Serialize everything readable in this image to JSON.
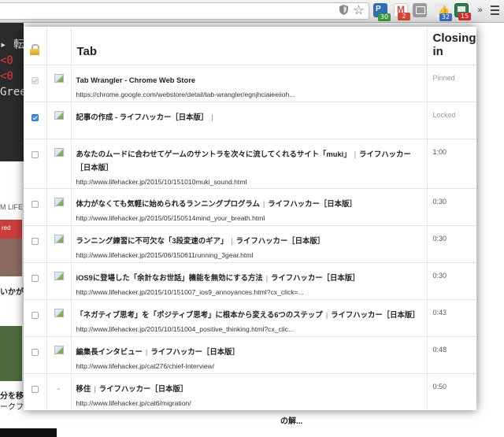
{
  "browser": {
    "extensions": [
      {
        "name": "pushbullet-icon",
        "badge": "30",
        "color": "#2f6db5",
        "badge_color": "#3a9a3a"
      },
      {
        "name": "gmail-icon",
        "badge": "2",
        "color": "#d44638",
        "badge_color": "#d44638"
      },
      {
        "name": "window-icon",
        "badge": "",
        "color": "#8a8a8a",
        "badge_color": ""
      },
      {
        "name": "feedly-icon",
        "badge": "32",
        "color": "#4a7bc8",
        "badge_color": "#3a6fc1"
      },
      {
        "name": "tab-wrangler-icon",
        "badge": "15",
        "color": "#3c9a5a",
        "badge_color": "#d0302a"
      }
    ],
    "overflow_label": "»"
  },
  "background_page": {
    "dark_lines": [
      "▸ 転",
      "<0",
      "<0",
      "Gree"
    ],
    "side_texts": [
      "M LIFE",
      "red",
      "いかが",
      "分を移",
      "ークフ"
    ],
    "bottom_text": "の解..."
  },
  "popup": {
    "header": {
      "tab_label": "Tab",
      "closing_label_line1": "Closing",
      "closing_label_line2": "in"
    },
    "rows": [
      {
        "checkbox": "disabled",
        "favicon": "image",
        "title": "Tab Wrangler - Chrome Web Store",
        "site": "",
        "url": "https://chrome.google.com/webstore/detail/tab-wrangler/egnjhciaieeiioh...",
        "closing": "Pinned",
        "muted": true
      },
      {
        "checkbox": "checked",
        "favicon": "image",
        "title": "記事の作成 - ライフハッカー［日本版］",
        "site": "",
        "url": "",
        "closing": "Locked",
        "muted": true,
        "trailing_sep": true
      },
      {
        "checkbox": "unchecked",
        "favicon": "image",
        "title": "あなたのムードに合わせてゲームのサントラを次々に流してくれるサイト「muki」",
        "site": "ライフハッカー［日本版］",
        "url": "http://www.lifehacker.jp/2015/10/151010muki_sound.html",
        "closing": "1:00",
        "muted": false
      },
      {
        "checkbox": "unchecked",
        "favicon": "image",
        "title": "体力がなくても気軽に始められるランニングプログラム",
        "site": "ライフハッカー［日本版］",
        "url": "http://www.lifehacker.jp/2015/05/150514mind_your_breath.html",
        "closing": "0:30",
        "muted": false
      },
      {
        "checkbox": "unchecked",
        "favicon": "image",
        "title": "ランニング練習に不可欠な「3段変速のギア」",
        "site": "ライフハッカー［日本版］",
        "url": "http://www.lifehacker.jp/2015/06/150611running_3gear.html",
        "closing": "0:30",
        "muted": false
      },
      {
        "checkbox": "unchecked",
        "favicon": "image",
        "title": "iOS9に登場した「余計なお世話」機能を無効にする方法",
        "site": "ライフハッカー［日本版］",
        "url": "http://www.lifehacker.jp/2015/10/151007_ios9_annoyances.html?cx_click=...",
        "closing": "0:30",
        "muted": false
      },
      {
        "checkbox": "unchecked",
        "favicon": "image",
        "title": "「ネガティブ思考」を「ポジティブ思考」に根本から変える6つのステップ",
        "site": "ライフハッカー［日本版］",
        "url": "http://www.lifehacker.jp/2015/10/151004_positive_thinking.html?cx_clic...",
        "closing": "0:43",
        "muted": false
      },
      {
        "checkbox": "unchecked",
        "favicon": "image",
        "title": "編集長インタビュー",
        "site": "ライフハッカー［日本版］",
        "url": "http://www.lifehacker.jp/cat276/chief-Interview/",
        "closing": "0:48",
        "muted": false
      },
      {
        "checkbox": "unchecked",
        "favicon": "none",
        "favicon_text": "-",
        "title": "移住",
        "site": "ライフハッカー［日本版］",
        "url": "http://www.lifehacker.jp/cat6/migration/",
        "closing": "0:50",
        "muted": false
      }
    ]
  }
}
